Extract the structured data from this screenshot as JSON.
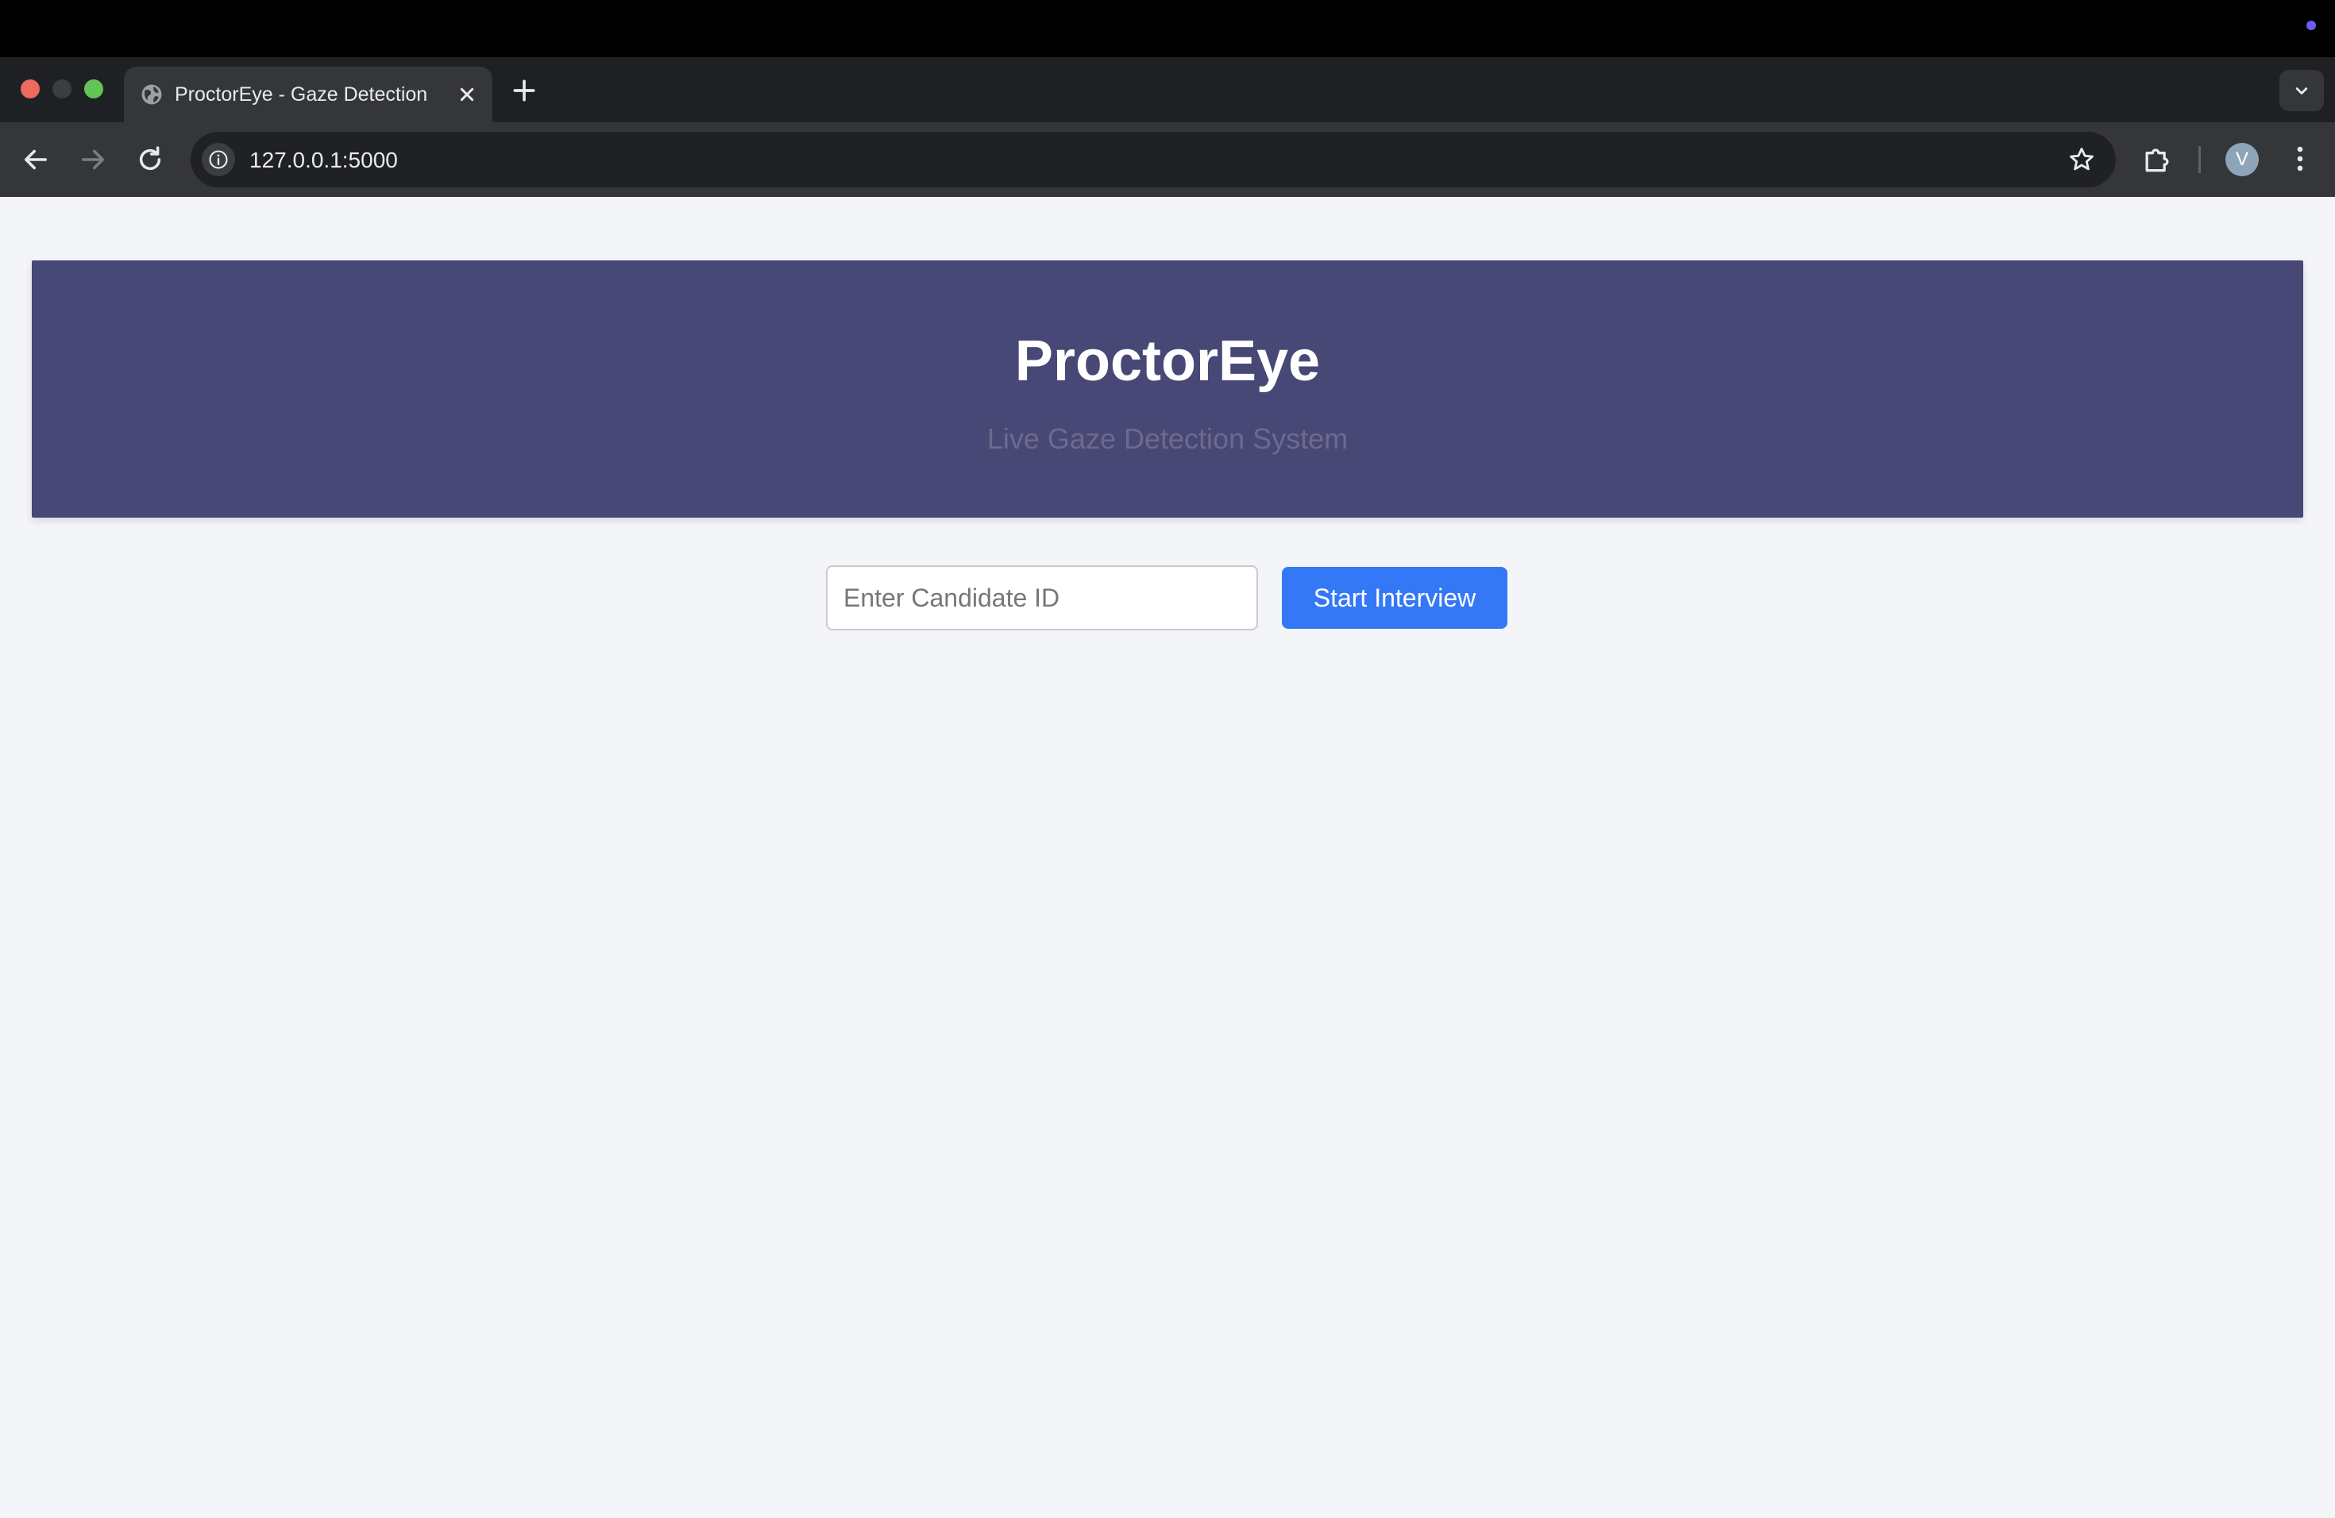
{
  "browser": {
    "tab": {
      "title": "ProctorEye - Gaze Detection",
      "favicon": "globe-icon"
    },
    "address_bar": {
      "url": "127.0.0.1:5000",
      "info_icon": "info-icon"
    },
    "profile_initial": "V",
    "icons": {
      "back": "back-arrow-icon",
      "forward": "forward-arrow-icon",
      "reload": "reload-icon",
      "new_tab": "plus-icon",
      "tabs_menu": "chevron-down-icon",
      "bookmark": "star-icon",
      "extensions": "puzzle-icon",
      "menu": "kebab-menu-icon"
    }
  },
  "page": {
    "header": {
      "title": "ProctorEye",
      "subtitle": "Live Gaze Detection System"
    },
    "form": {
      "candidate_placeholder": "Enter Candidate ID",
      "candidate_value": "",
      "start_button_label": "Start Interview"
    }
  },
  "colors": {
    "header_bg": "#474875",
    "primary_button": "#3578f6",
    "page_bg": "#f4f5f9",
    "os_indicator": "#6e5cf6"
  }
}
